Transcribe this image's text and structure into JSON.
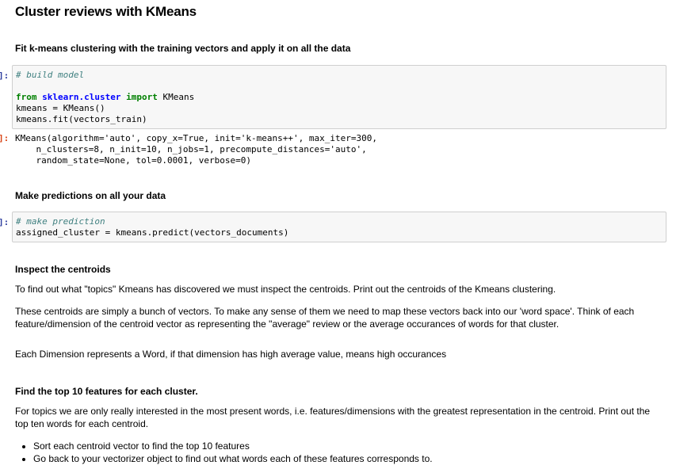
{
  "title": "Cluster reviews with KMeans",
  "section_fit": "Fit k-means clustering with the training vectors and apply it on all the data",
  "prompt_in": "]:",
  "prompt_out": "]:",
  "cell1": {
    "comment": "# build model",
    "kw_from": "from",
    "module": "sklearn.cluster",
    "kw_import": "import",
    "import_name": " KMeans",
    "line2": "kmeans = KMeans()",
    "line3": "kmeans.fit(vectors_train)"
  },
  "output1": {
    "line1": "KMeans(algorithm='auto', copy_x=True, init='k-means++', max_iter=300,",
    "line2": "    n_clusters=8, n_init=10, n_jobs=1, precompute_distances='auto',",
    "line3": "    random_state=None, tol=0.0001, verbose=0)"
  },
  "section_predict": "Make predictions on all your data",
  "cell2": {
    "comment": "# make prediction",
    "line2": "assigned_cluster = kmeans.predict(vectors_documents)"
  },
  "section_inspect": "Inspect the centroids",
  "para1": "To find out what \"topics\" Kmeans has discovered we must inspect the centroids. Print out the centroids of the Kmeans clustering.",
  "para2": "These centroids are simply a bunch of vectors. To make any sense of them we need to map these vectors back into our 'word space'. Think of each feature/dimension of the centroid vector as representing the \"average\" review or the average occurances of words for that cluster.",
  "para3": "Each Dimension represents a Word, if that dimension has high average value, means high occurances",
  "section_top10": "Find the top 10 features for each cluster.",
  "para4": "For topics we are only really interested in the most present words, i.e. features/dimensions with the greatest representation in the centroid. Print out the top ten words for each centroid.",
  "bullets": [
    "Sort each centroid vector to find the top 10 features",
    "Go back to your vectorizer object to find out what words each of these features corresponds to."
  ]
}
